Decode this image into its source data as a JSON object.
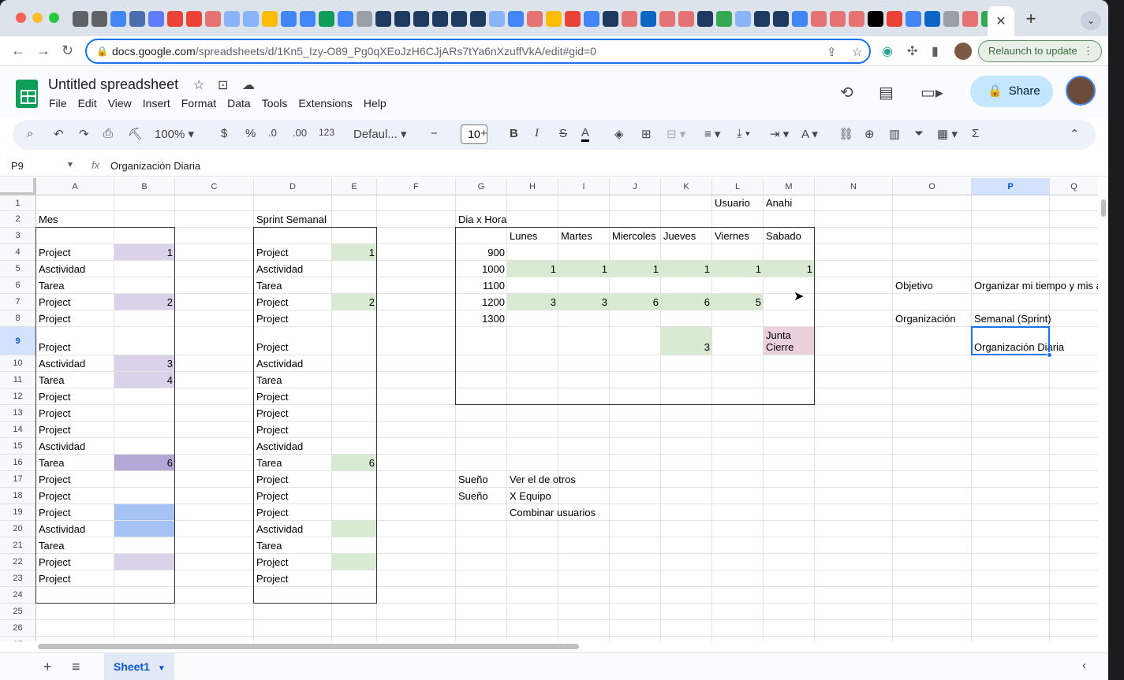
{
  "browser": {
    "url_host": "docs.google.com",
    "url_path": "/spreadsheets/d/1Kn5_Izy-O89_Pg0qXEoJzH6CJjARs7tYa6nXzuffVkA/edit#gid=0",
    "relaunch_label": "Relaunch to update",
    "colors": {
      "close": "#ff5f57",
      "minimize": "#febc2e",
      "maximize": "#28c840"
    }
  },
  "app": {
    "title": "Untitled spreadsheet",
    "menus": [
      "File",
      "Edit",
      "View",
      "Insert",
      "Format",
      "Data",
      "Tools",
      "Extensions",
      "Help"
    ],
    "share_label": "Share"
  },
  "toolbar": {
    "zoom": "100%",
    "currency": "$",
    "percent": "%",
    "dec_decrease": ".0",
    "dec_increase": ".00",
    "number_format": "123",
    "font": "Defaul...",
    "font_size": "10"
  },
  "formula": {
    "cell_ref": "P9",
    "content": "Organización Diaria"
  },
  "columns": [
    "A",
    "B",
    "C",
    "D",
    "E",
    "F",
    "G",
    "H",
    "I",
    "J",
    "K",
    "L",
    "M",
    "N",
    "O",
    "P",
    "Q"
  ],
  "rows": [
    "1",
    "2",
    "3",
    "4",
    "5",
    "6",
    "7",
    "8",
    "9",
    "10",
    "11",
    "12",
    "13",
    "14",
    "15",
    "16",
    "17",
    "18",
    "19",
    "20",
    "21",
    "22",
    "23",
    "24",
    "25",
    "26",
    "27"
  ],
  "cells": {
    "L1": "Usuario",
    "M1": "Anahi",
    "A2": "Mes",
    "D2": "Sprint Semanal",
    "G2": "Dia x Hora",
    "H3": "Lunes",
    "I3": "Martes",
    "J3": "Miercoles",
    "K3": "Jueves",
    "L3": "Viernes",
    "M3": "Sabado",
    "A4": "Project",
    "B4": "1",
    "D4": "Project",
    "E4": "1",
    "G4": "900",
    "A5": "Asctividad",
    "D5": "Asctividad",
    "G5": "1000",
    "H5": "1",
    "I5": "1",
    "J5": "1",
    "K5": "1",
    "L5": "1",
    "M5": "1",
    "A6": "Tarea",
    "D6": "Tarea",
    "G6": "1100",
    "O6": "Objetivo",
    "P6": "Organizar mi tiempo y mis a",
    "A7": "Project",
    "B7": "2",
    "D7": "Project",
    "E7": "2",
    "G7": "1200",
    "H7": "3",
    "I7": "3",
    "J7": "6",
    "K7": "6",
    "L7": "5",
    "A8": "Project",
    "D8": "Project",
    "G8": "1300",
    "O8": "Organización",
    "P8": "Semanal (Sprint)",
    "A9": "Project",
    "D9": "Project",
    "K9": "3",
    "M9a": "Junta",
    "M9b": "Cierre",
    "P9": "Organización Diaria",
    "A10": "Asctividad",
    "B10": "3",
    "D10": "Asctividad",
    "A11": "Tarea",
    "B11": "4",
    "D11": "Tarea",
    "A12": "Project",
    "D12": "Project",
    "A13": "Project",
    "D13": "Project",
    "A14": "Project",
    "D14": "Project",
    "A15": "Asctividad",
    "D15": "Asctividad",
    "A16": "Tarea",
    "B16": "6",
    "D16": "Tarea",
    "E16": "6",
    "A17": "Project",
    "D17": "Project",
    "G17": "Sueño",
    "H17": "Ver el de otros",
    "A18": "Project",
    "D18": "Project",
    "G18": "Sueño",
    "H18": "X Equipo",
    "A19": "Project",
    "D19": "Project",
    "H19": "Combinar usuarios",
    "A20": "Asctividad",
    "D20": "Asctividad",
    "A21": "Tarea",
    "D21": "Tarea",
    "A22": "Project",
    "D22": "Project",
    "A23": "Project",
    "D23": "Project"
  },
  "fill_colors": {
    "lavender": "#d9d2e9",
    "purple": "#b4a7d6",
    "blue": "#a4c2f4",
    "green": "#d9ead3",
    "pink": "#ead1dc",
    "selection": "#1a73e8"
  },
  "sheet": {
    "tab_label": "Sheet1"
  }
}
